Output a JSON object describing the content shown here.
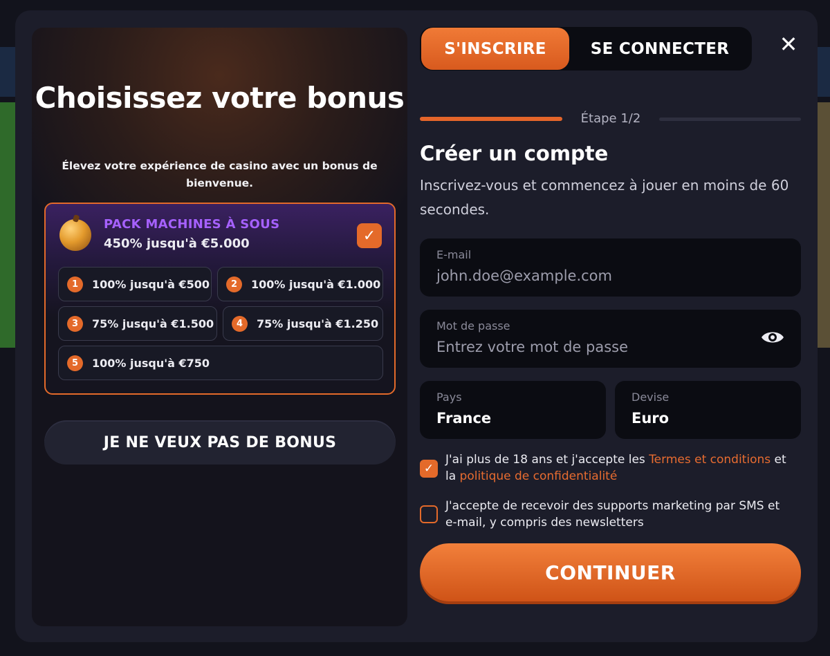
{
  "left": {
    "title": "Choisissez votre bonus",
    "subtitle": "Élevez votre expérience de casino avec un bonus de bienvenue.",
    "pack": {
      "name": "PACK MACHINES À SOUS",
      "description": "450% jusqu'à €5.000",
      "selected": true,
      "tiers": [
        {
          "num": "1",
          "text": "100% jusqu'à €500"
        },
        {
          "num": "2",
          "text": "100% jusqu'à €1.000"
        },
        {
          "num": "3",
          "text": "75% jusqu'à €1.500"
        },
        {
          "num": "4",
          "text": "75% jusqu'à €1.250"
        },
        {
          "num": "5",
          "text": "100% jusqu'à €750"
        }
      ]
    },
    "no_bonus_label": "JE NE VEUX PAS DE BONUS"
  },
  "tabs": {
    "signup": "S'INSCRIRE",
    "login": "SE CONNECTER",
    "active": "signup"
  },
  "step": {
    "label": "Étape 1/2",
    "current": 1,
    "total": 2
  },
  "form": {
    "title": "Créer un compte",
    "subtitle": "Inscrivez-vous et commencez à jouer en moins de 60 secondes.",
    "email": {
      "label": "E-mail",
      "placeholder": "john.doe@example.com"
    },
    "password": {
      "label": "Mot de passe",
      "placeholder": "Entrez votre mot de passe"
    },
    "country": {
      "label": "Pays",
      "value": "France"
    },
    "currency": {
      "label": "Devise",
      "value": "Euro"
    },
    "terms": {
      "checked": true,
      "prefix": "J'ai plus de 18 ans et j'accepte les ",
      "link1": "Termes et conditions",
      "middle": " et la ",
      "link2": "politique de confidentialité"
    },
    "marketing": {
      "checked": false,
      "text": "J'accepte de recevoir des supports marketing par SMS et e-mail, y compris des newsletters"
    },
    "continue_label": "CONTINUER"
  },
  "colors": {
    "accent": "#e46a2a",
    "purple": "#a661ff",
    "panel": "#1c1d2a"
  },
  "icons": [
    "close-icon",
    "check-icon",
    "eye-icon",
    "slot-orb-icon"
  ]
}
